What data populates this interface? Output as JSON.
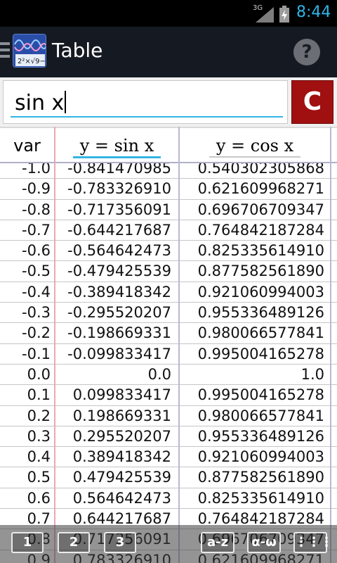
{
  "status_bar": {
    "network": "3G",
    "time": "8:44",
    "accent": "#2fb4e6"
  },
  "action_bar": {
    "title": "Table",
    "help_label": "?"
  },
  "input": {
    "value": "sin x",
    "clear_label": "C"
  },
  "table": {
    "headers": [
      "var",
      "y = sin x",
      "y = cos x"
    ],
    "rows": [
      [
        "-1.0",
        "-0.841470985",
        "0.540302305868"
      ],
      [
        "-0.9",
        "-0.783326910",
        "0.621609968271"
      ],
      [
        "-0.8",
        "-0.717356091",
        "0.696706709347"
      ],
      [
        "-0.7",
        "-0.644217687",
        "0.764842187284"
      ],
      [
        "-0.6",
        "-0.564642473",
        "0.825335614910"
      ],
      [
        "-0.5",
        "-0.479425539",
        "0.877582561890"
      ],
      [
        "-0.4",
        "-0.389418342",
        "0.921060994003"
      ],
      [
        "-0.3",
        "-0.295520207",
        "0.955336489126"
      ],
      [
        "-0.2",
        "-0.198669331",
        "0.980066577841"
      ],
      [
        "-0.1",
        "-0.099833417",
        "0.995004165278"
      ],
      [
        "0.0",
        "0.0",
        "1.0"
      ],
      [
        "0.1",
        "0.099833417",
        "0.995004165278"
      ],
      [
        "0.2",
        "0.198669331",
        "0.980066577841"
      ],
      [
        "0.3",
        "0.295520207",
        "0.955336489126"
      ],
      [
        "0.4",
        "0.389418342",
        "0.921060994003"
      ],
      [
        "0.5",
        "0.479425539",
        "0.877582561890"
      ],
      [
        "0.6",
        "0.564642473",
        "0.825335614910"
      ],
      [
        "0.7",
        "0.644217687",
        "0.764842187284"
      ],
      [
        "0.8",
        "0.717356091",
        "0.696706709347"
      ],
      [
        "0.9",
        "0.783326910",
        "0.621609968271"
      ]
    ]
  },
  "toolbar": {
    "buttons": [
      "1",
      "2",
      "3",
      "a-z",
      "α-ω",
      "⋮⋮⋮"
    ]
  }
}
